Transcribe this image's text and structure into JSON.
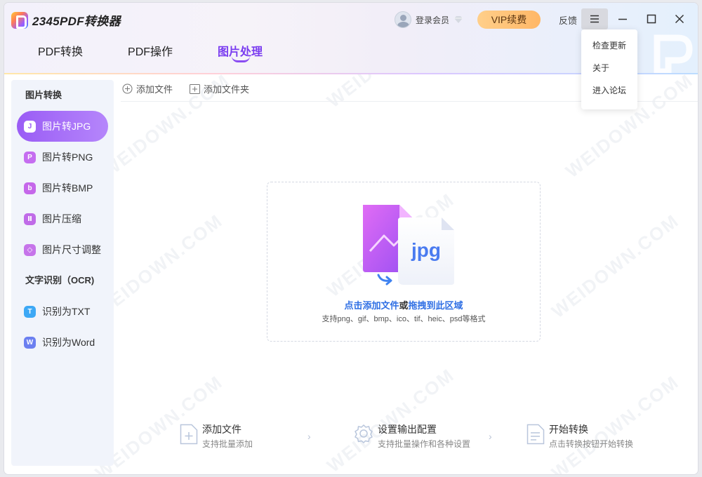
{
  "app": {
    "title": "2345PDF转换器"
  },
  "header": {
    "tabs": [
      {
        "label": "PDF转换",
        "active": false
      },
      {
        "label": "PDF操作",
        "active": false
      },
      {
        "label": "图片处理",
        "active": true
      }
    ],
    "login_label": "登录会员",
    "vip_label": "VIP续费",
    "feedback_label": "反馈"
  },
  "menu": {
    "items": [
      {
        "label": "检查更新"
      },
      {
        "label": "关于"
      },
      {
        "label": "进入论坛"
      }
    ]
  },
  "sidebar": {
    "section1": "图片转换",
    "section2": "文字识别（OCR)",
    "items": [
      {
        "label": "图片转JPG",
        "icon": "jpg-icon",
        "glyph": "J",
        "color": "#ffffff",
        "active": true
      },
      {
        "label": "图片转PNG",
        "icon": "png-icon",
        "glyph": "P",
        "color": "#c56df0"
      },
      {
        "label": "图片转BMP",
        "icon": "bmp-icon",
        "glyph": "b",
        "color": "#c567ea"
      },
      {
        "label": "图片压缩",
        "icon": "compress-icon",
        "glyph": "Ⅱ",
        "color": "#c06be8"
      },
      {
        "label": "图片尺寸调整",
        "icon": "resize-icon",
        "glyph": "◇",
        "color": "#c674ea"
      },
      {
        "label": "识别为TXT",
        "icon": "txt-icon",
        "glyph": "T",
        "color": "#3da8f5"
      },
      {
        "label": "识别为Word",
        "icon": "word-icon",
        "glyph": "W",
        "color": "#6b7ff0"
      }
    ]
  },
  "toolbar": {
    "add_file": "添加文件",
    "add_folder": "添加文件夹"
  },
  "dropzone": {
    "badge": "jpg",
    "prefix": "点击",
    "link1": "添加文件",
    "or": "或",
    "link2": "拖拽到此区域",
    "formats": "支持png、gif、bmp、ico、tif、heic、psd等格式"
  },
  "steps": [
    {
      "title": "添加文件",
      "sub": "支持批量添加"
    },
    {
      "title": "设置输出配置",
      "sub": "支持批量操作和各种设置"
    },
    {
      "title": "开始转换",
      "sub": "点击转换按钮开始转换"
    }
  ],
  "watermark": "WEIDOWN.COM"
}
